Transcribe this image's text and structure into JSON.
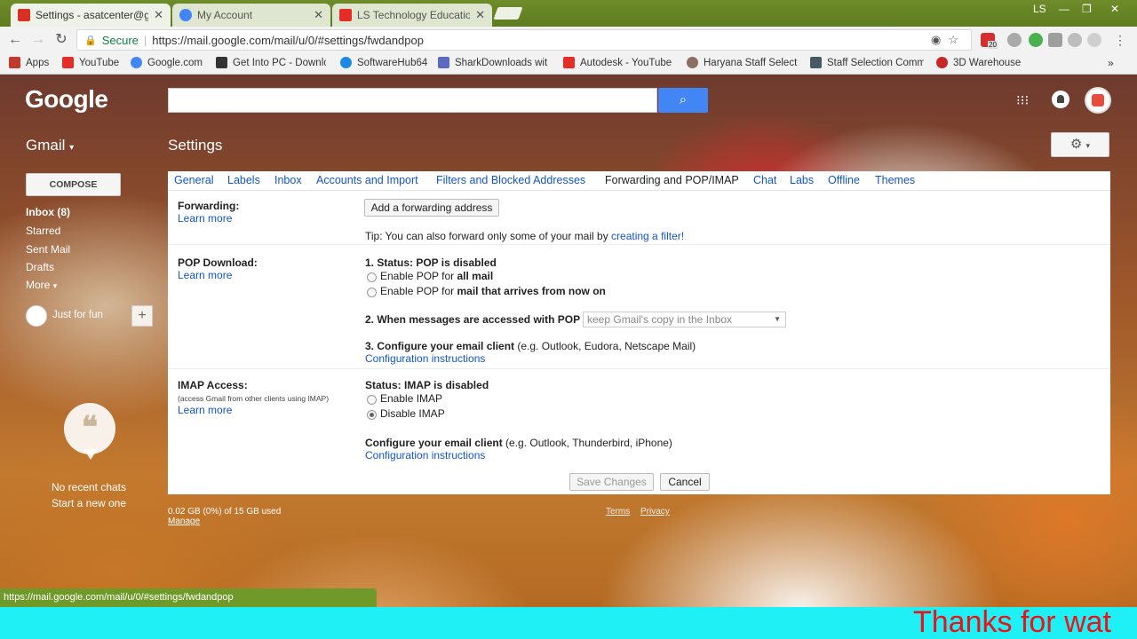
{
  "browser": {
    "tabs": [
      {
        "title": "Settings - asatcenter@g",
        "color": "#d93025"
      },
      {
        "title": "My Account",
        "color": "#4285f4"
      },
      {
        "title": "LS Technology Educatio",
        "color": "#e52d27"
      }
    ],
    "window_user": "LS",
    "secure_label": "Secure",
    "url": "https://mail.google.com/mail/u/0/#settings/fwdandpop",
    "extension_badge": "20",
    "status_url": "https://mail.google.com/mail/u/0/#settings/fwdandpop"
  },
  "bookmarks": [
    {
      "label": "Apps",
      "color": "#c0392b"
    },
    {
      "label": "YouTube",
      "color": "#e52d27"
    },
    {
      "label": "Google.com",
      "color": "#4285f4"
    },
    {
      "label": "Get Into PC - Downlo",
      "color": "#333333"
    },
    {
      "label": "SoftwareHub64",
      "color": "#1e88e5"
    },
    {
      "label": "SharkDownloads wit",
      "color": "#5c6bc0"
    },
    {
      "label": "Autodesk - YouTube",
      "color": "#e52d27"
    },
    {
      "label": "Haryana Staff Selecti",
      "color": "#8d6e63"
    },
    {
      "label": "Staff Selection Comm",
      "color": "#455a64"
    },
    {
      "label": "3D Warehouse",
      "color": "#c62828"
    }
  ],
  "gmail": {
    "logo": "Google",
    "app_label": "Gmail",
    "page_title": "Settings",
    "compose": "COMPOSE",
    "nav": [
      "Inbox (8)",
      "Starred",
      "Sent Mail",
      "Drafts",
      "More"
    ],
    "hangout_user": "Just for fun",
    "no_chats": "No recent chats",
    "start_new": "Start a new one"
  },
  "settings": {
    "tabs": [
      "General",
      "Labels",
      "Inbox",
      "Accounts and Import",
      "Filters and Blocked Addresses",
      "Forwarding and POP/IMAP",
      "Chat",
      "Labs",
      "Offline",
      "Themes"
    ],
    "active_tab": "Forwarding and POP/IMAP",
    "learn_more": "Learn more",
    "forwarding": {
      "label": "Forwarding:",
      "add_button": "Add a forwarding address",
      "tip_prefix": "Tip: You can also forward only some of your mail by ",
      "tip_link": "creating a filter!"
    },
    "pop": {
      "label": "POP Download:",
      "status": "1. Status: POP is disabled",
      "opt1_prefix": "Enable POP for ",
      "opt1_bold": "all mail",
      "opt2_prefix": "Enable POP for ",
      "opt2_bold": "mail that arrives from now on",
      "when": "2. When messages are accessed with POP",
      "when_select": "keep Gmail's copy in the Inbox",
      "configure": "3. Configure your email client",
      "configure_eg": " (e.g. Outlook, Eudora, Netscape Mail)",
      "config_link": "Configuration instructions"
    },
    "imap": {
      "label": "IMAP Access:",
      "note": "(access Gmail from other clients using IMAP)",
      "status": "Status: IMAP is disabled",
      "enable": "Enable IMAP",
      "disable": "Disable IMAP",
      "selected": "Disable IMAP",
      "configure": "Configure your email client",
      "configure_eg": " (e.g. Outlook, Thunderbird, iPhone)",
      "config_link": "Configuration instructions"
    },
    "save": "Save Changes",
    "cancel": "Cancel"
  },
  "footer": {
    "storage": "0.02 GB (0%) of 15 GB used",
    "manage": "Manage",
    "terms": "Terms",
    "privacy": "Privacy"
  },
  "overlay": {
    "thanks": "Thanks for wat"
  }
}
